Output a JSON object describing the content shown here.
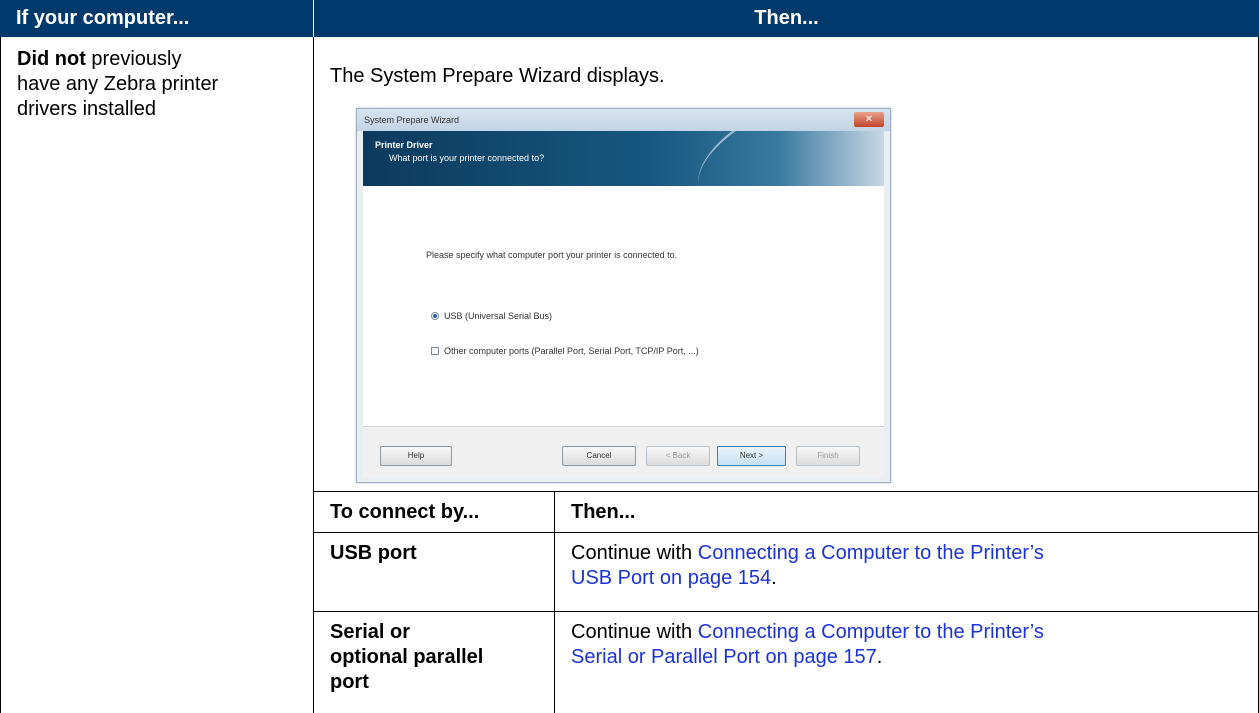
{
  "table": {
    "header_left": "If your computer...",
    "header_right": "Then...",
    "condition_bold": "Did not",
    "condition_line1_rest": " previously",
    "condition_line2": "have any Zebra printer",
    "condition_line3": "drivers installed",
    "result_text": "The System Prepare Wizard displays."
  },
  "wizard": {
    "title": "System Prepare Wizard",
    "close_glyph": "✕",
    "banner_title": "Printer Driver",
    "banner_subtitle": "What port is your printer connected to?",
    "prompt": "Please specify what computer port your printer is connected to.",
    "option_usb": "USB (Universal Serial Bus)",
    "option_other": "Other computer ports (Parallel Port, Serial Port, TCP/IP Port, ...)",
    "usb_selected": true,
    "buttons": {
      "help": "Help",
      "cancel": "Cancel",
      "back": "< Back",
      "next": "Next >",
      "finish": "Finish"
    }
  },
  "subtable": {
    "header_left": "To connect by...",
    "header_right": "Then...",
    "row1_left": "USB port",
    "row1_prefix": "Continue with ",
    "row1_link_line1": "Connecting a Computer to the Printer’s",
    "row1_link_line2": "USB Port on page 154",
    "row1_suffix": ".",
    "row2_left_line1": "Serial or",
    "row2_left_line2": "optional parallel",
    "row2_left_line3": "port",
    "row2_prefix": "Continue with ",
    "row2_link_line1": "Connecting a Computer to the Printer’s",
    "row2_link_line2": "Serial or Parallel Port on page 157",
    "row2_suffix": "."
  },
  "colors": {
    "header_bg": "#00396b",
    "link": "#1a33d6"
  }
}
